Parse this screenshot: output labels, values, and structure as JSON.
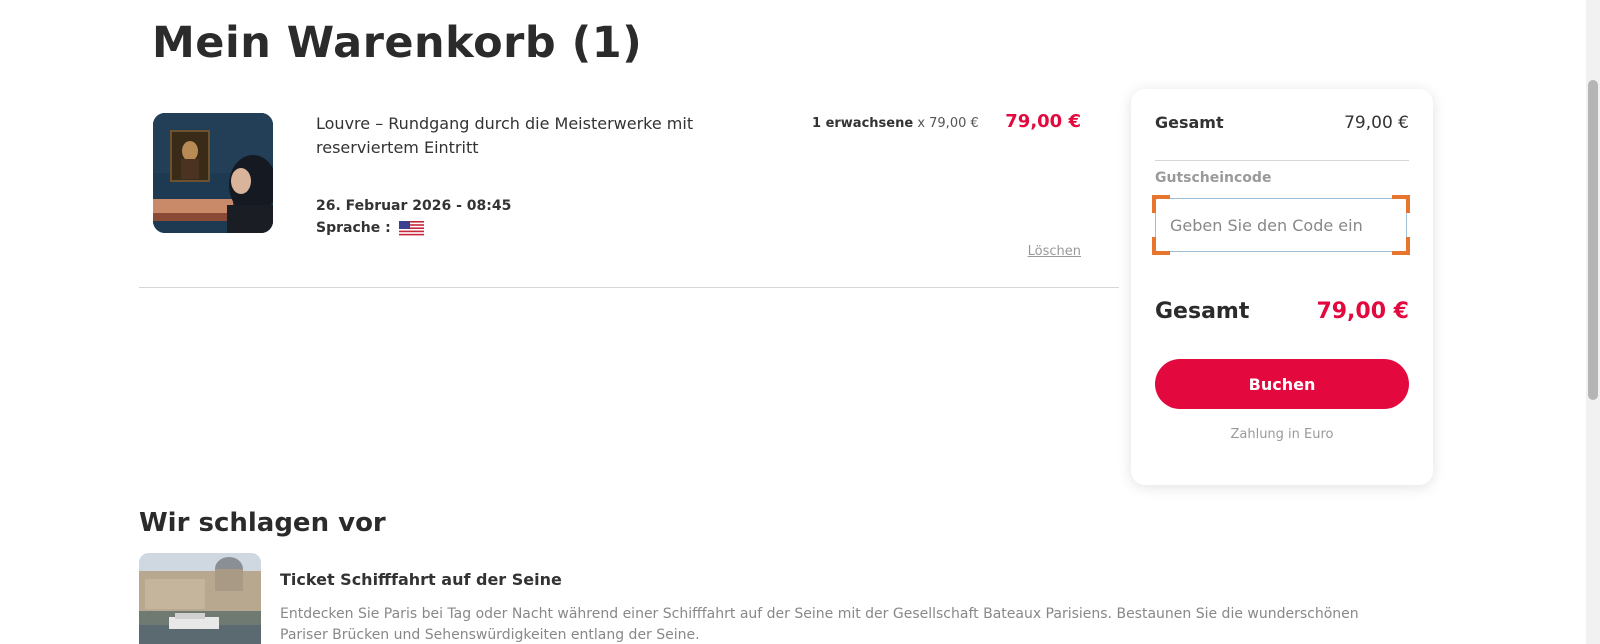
{
  "page_title": "Mein Warenkorb (1)",
  "cart_item": {
    "title": "Louvre – Rundgang durch die Meisterwerke mit reserviertem Eintritt",
    "date": "26. Februar 2026 - 08:45",
    "language_label": "Sprache :",
    "language_flag": "us-flag-icon",
    "qty_label": "1 erwachsene",
    "qty_unit_price": "x 79,00 €",
    "price": "79,00 €",
    "delete_label": "Löschen"
  },
  "summary": {
    "subtotal_label": "Gesamt",
    "subtotal_value": "79,00 €",
    "coupon_label": "Gutscheincode",
    "coupon_placeholder": "Geben Sie den Code ein",
    "coupon_value": "",
    "total_label": "Gesamt",
    "total_value": "79,00 €",
    "book_button": "Buchen",
    "payment_note": "Zahlung in Euro"
  },
  "suggestions": {
    "heading": "Wir schlagen vor",
    "items": [
      {
        "name": "Ticket Schifffahrt auf der Seine",
        "description": "Entdecken Sie Paris bei Tag oder Nacht während einer Schifffahrt auf der Seine mit der Gesellschaft Bateaux Parisiens. Bestaunen Sie die wunderschönen Pariser Brücken und Sehenswürdigkeiten entlang der Seine."
      }
    ]
  },
  "colors": {
    "accent": "#e3093e",
    "focus_corners": "#e8752d"
  }
}
